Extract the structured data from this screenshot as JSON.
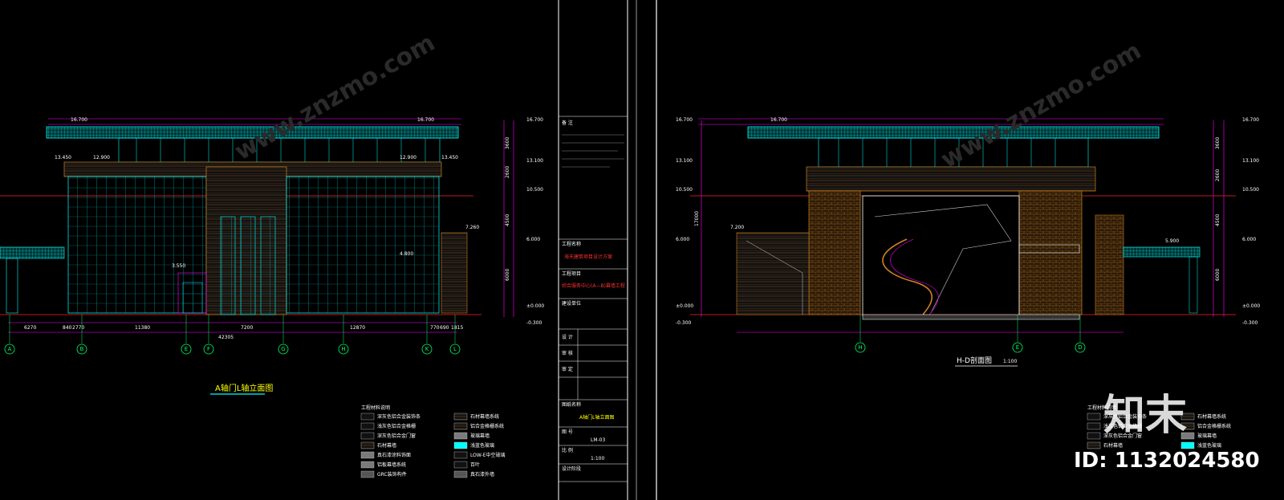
{
  "left_drawing": {
    "title": "A轴门L轴立面图",
    "top_levels": [
      "16.700",
      "16.700"
    ],
    "level_12900": "12.900",
    "level_13450": "13.450",
    "level_13100": "13.100",
    "level_10500": "10.500",
    "level_7260": "7.260",
    "level_6000": "6.000",
    "level_4800": "4.800",
    "level_3550": "3.550",
    "level_0": "±0.000",
    "level_neg": "-0.300",
    "dims": [
      "6270",
      "840",
      "2770",
      "11380",
      "7200",
      "12870",
      "770",
      "690",
      "1815"
    ],
    "total_dim": "42305",
    "axes": [
      "A",
      "B",
      "E",
      "F",
      "G",
      "H",
      "K",
      "L"
    ],
    "right_dims": [
      "3600",
      "2600",
      "4500",
      "6000"
    ]
  },
  "title_block": {
    "note_label": "备 注",
    "project_label": "工程名称",
    "project_name": "海天建筑项目设计方案",
    "subproject_label": "工程项目",
    "subproject_name": "综合服务中心(A—B)幕墙工程",
    "client_label": "建设单位",
    "sign_labels": [
      "设 计",
      "审 核",
      "审 定"
    ],
    "drawing_label": "图纸名称",
    "drawing_name": "A轴门L轴立面图",
    "number_label": "图 号",
    "number": "LM-03",
    "scale_label": "比 例",
    "scale": "1:100",
    "phase_label": "设计阶段"
  },
  "right_drawing": {
    "title": "H-D剖面图",
    "scale": "1:100",
    "level_top": "16.700",
    "level_13100": "13.100",
    "level_10500": "10.500",
    "level_7200": "7.200",
    "level_6000": "6.000",
    "level_5900": "5.900",
    "level_0": "±0.000",
    "level_neg": "-0.300",
    "axes": [
      "H",
      "E",
      "D"
    ],
    "side_dims": [
      "3600",
      "2600",
      "4500",
      "6000",
      "17000"
    ]
  },
  "legend": {
    "heading": "工程材料说明",
    "items_left": [
      "深灰色铝合金装饰条",
      "浅灰色铝合金格栅",
      "深灰色铝合金门窗",
      "石材幕墙",
      "真石漆涂料饰面",
      "铝板幕墙系统",
      "GRC装饰构件"
    ],
    "items_right": [
      "石材幕墙系统",
      "铝合金格栅系统",
      "玻璃幕墙",
      "浅蓝色玻璃",
      "LOW-E中空玻璃",
      "百叶",
      "真石漆外墙"
    ],
    "colors": {
      "cyan": "#00ffff",
      "grey": "#7a7a7a"
    }
  },
  "watermark": {
    "brand": "知末",
    "id_text": "ID: 1132024580",
    "site": "www.znzmo.com"
  },
  "colors": {
    "background": "#000000",
    "cyan": "#00ffff",
    "magenta": "#ff00ff",
    "green": "#00ff66",
    "red": "#ff2020",
    "yellow": "#ffff00",
    "orange": "#d08020",
    "white": "#ffffff"
  }
}
